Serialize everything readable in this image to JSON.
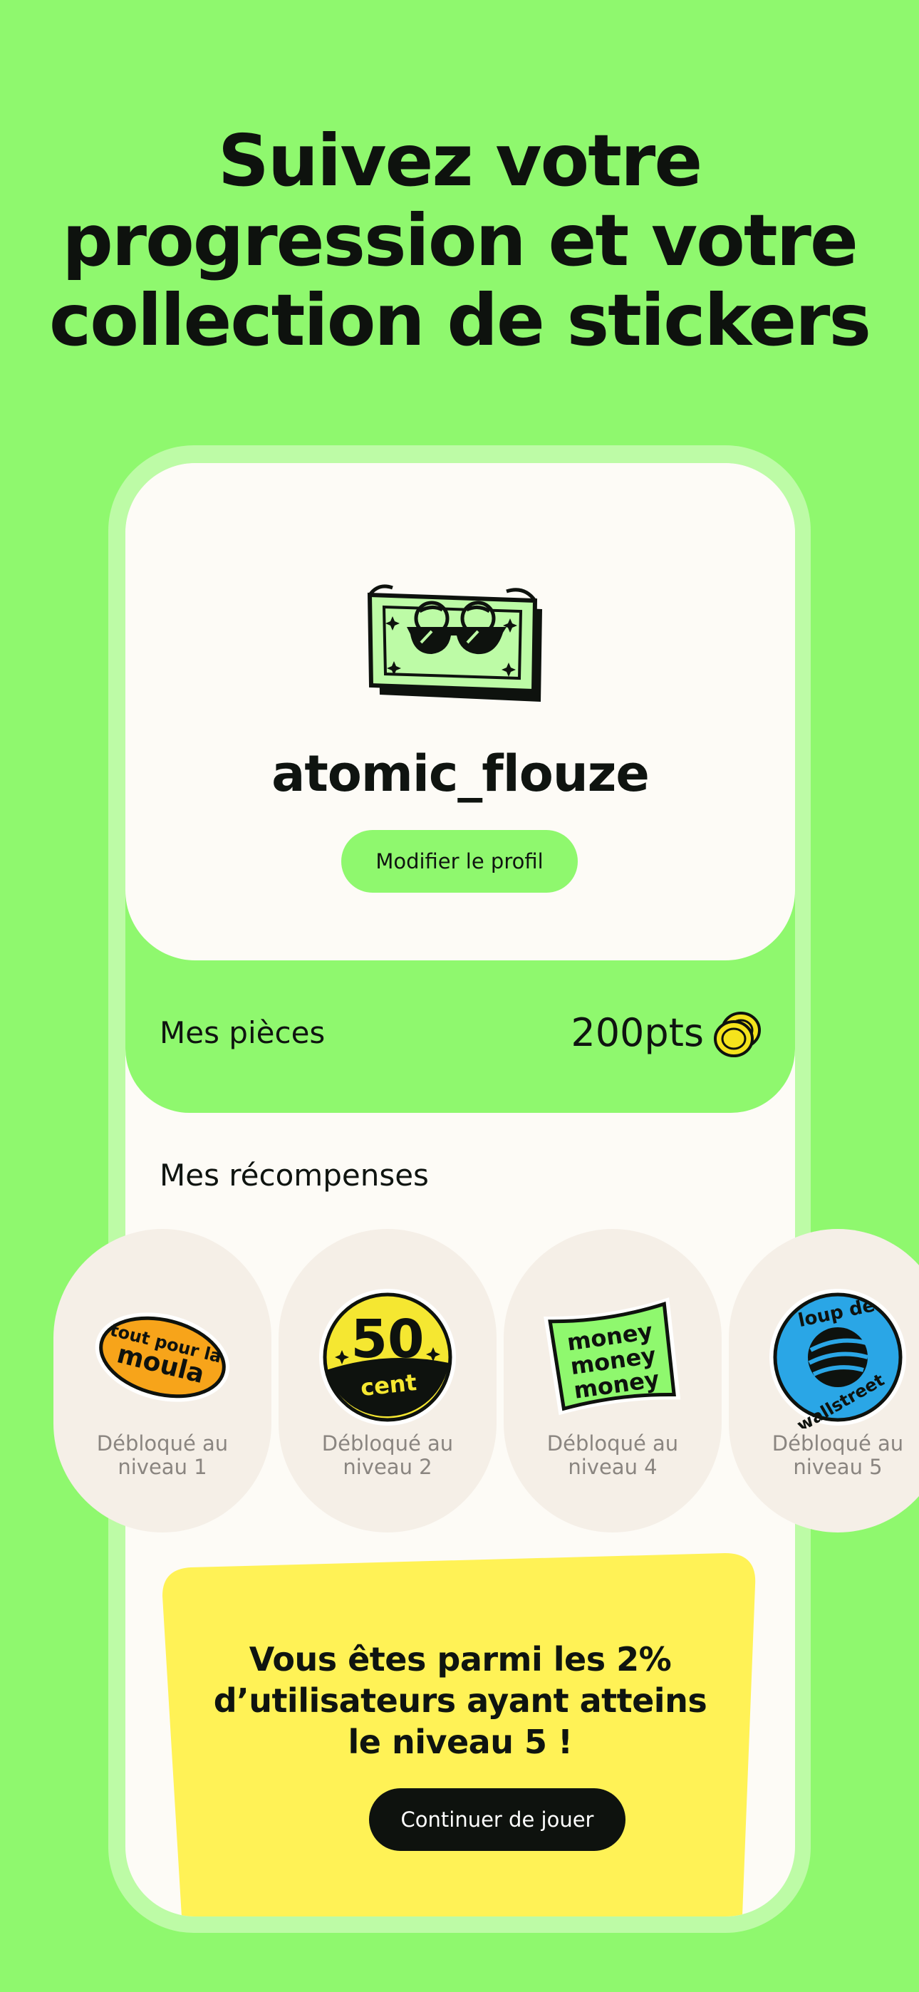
{
  "headline": {
    "line1": "Suivez votre",
    "line2": "progression et votre",
    "line3": "collection de stickers"
  },
  "profile": {
    "username": "atomic_flouze",
    "edit_button": "Modifier le profil",
    "avatar_icon": "money-bill-sunglasses-icon"
  },
  "coins": {
    "label": "Mes pièces",
    "value": "200pts",
    "icon": "coins-icon"
  },
  "rewards": {
    "title": "Mes récompenses",
    "items": [
      {
        "sticker": "tout pour la moula",
        "caption_line1": "Débloqué au",
        "caption_line2": "niveau 1"
      },
      {
        "sticker": "50 cent",
        "caption_line1": "Débloqué au",
        "caption_line2": "niveau 2"
      },
      {
        "sticker": "money money money",
        "caption_line1": "Débloqué au",
        "caption_line2": "niveau 4"
      },
      {
        "sticker": "loup de wallstreet",
        "caption_line1": "Débloqué au",
        "caption_line2": "niveau 5"
      }
    ]
  },
  "banner": {
    "line1": "Vous êtes parmi les 2%",
    "line2": "d’utilisateurs ayant atteins",
    "line3": "le niveau 5 !",
    "button": "Continuer de jouer"
  },
  "colors": {
    "background": "#8ff86e",
    "card": "#fdfbf6",
    "banner": "#fff256",
    "dark": "#0e120e"
  }
}
